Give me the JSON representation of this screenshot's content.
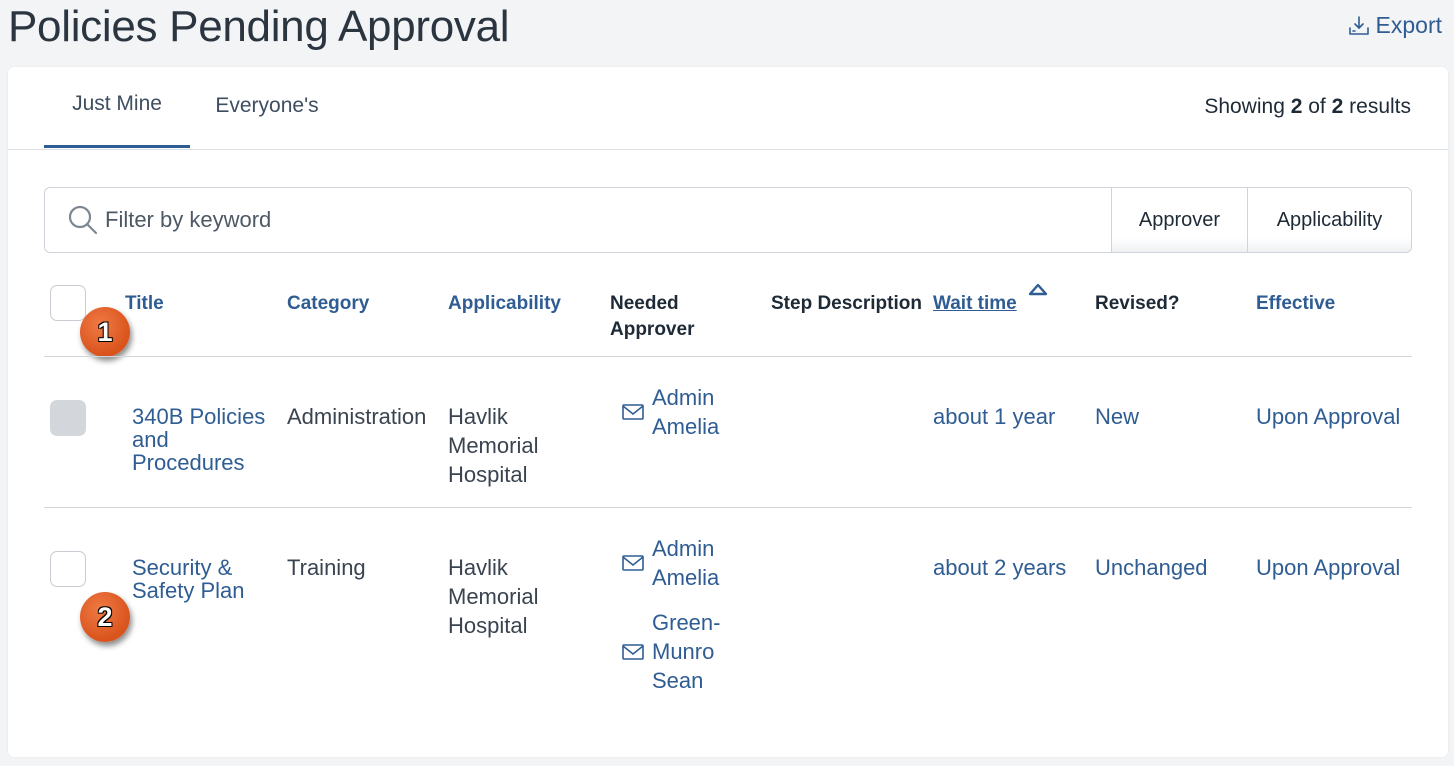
{
  "page": {
    "title": "Policies Pending Approval",
    "export_label": "Export"
  },
  "tabs": [
    {
      "label": "Just Mine",
      "active": true
    },
    {
      "label": "Everyone's",
      "active": false
    }
  ],
  "results": {
    "prefix": "Showing",
    "shown": "2",
    "of": "of",
    "total": "2",
    "suffix": "results"
  },
  "filter": {
    "placeholder": "Filter by keyword",
    "approver_label": "Approver",
    "applicability_label": "Applicability"
  },
  "columns": {
    "title": "Title",
    "category": "Category",
    "applicability": "Applicability",
    "needed_approver_1": "Needed",
    "needed_approver_2": "Approver",
    "step_description": "Step Description",
    "wait_time": "Wait time",
    "revised": "Revised?",
    "effective": "Effective"
  },
  "rows": [
    {
      "title_lines": [
        "340B Policies",
        "and",
        "Procedures"
      ],
      "category": "Administration",
      "applicability_lines": [
        "Havlik",
        "Memorial",
        "Hospital"
      ],
      "approvers": [
        {
          "lines": [
            "Admin",
            "Amelia"
          ]
        }
      ],
      "wait_time": "about 1 year",
      "revised": "New",
      "effective": "Upon Approval",
      "checkbox_state": "filled"
    },
    {
      "title_lines": [
        "Security &",
        "Safety Plan"
      ],
      "category": "Training",
      "applicability_lines": [
        "Havlik",
        "Memorial",
        "Hospital"
      ],
      "approvers": [
        {
          "lines": [
            "Admin",
            "Amelia"
          ]
        },
        {
          "lines": [
            "Green-",
            "Munro",
            "Sean"
          ]
        }
      ],
      "wait_time": "about 2 years",
      "revised": "Unchanged",
      "effective": "Upon Approval",
      "checkbox_state": "empty"
    }
  ],
  "callouts": [
    "1",
    "2"
  ],
  "colors": {
    "link": "#2f5d93",
    "badge": "#e2622a",
    "tab_underline": "#2f5d93"
  }
}
